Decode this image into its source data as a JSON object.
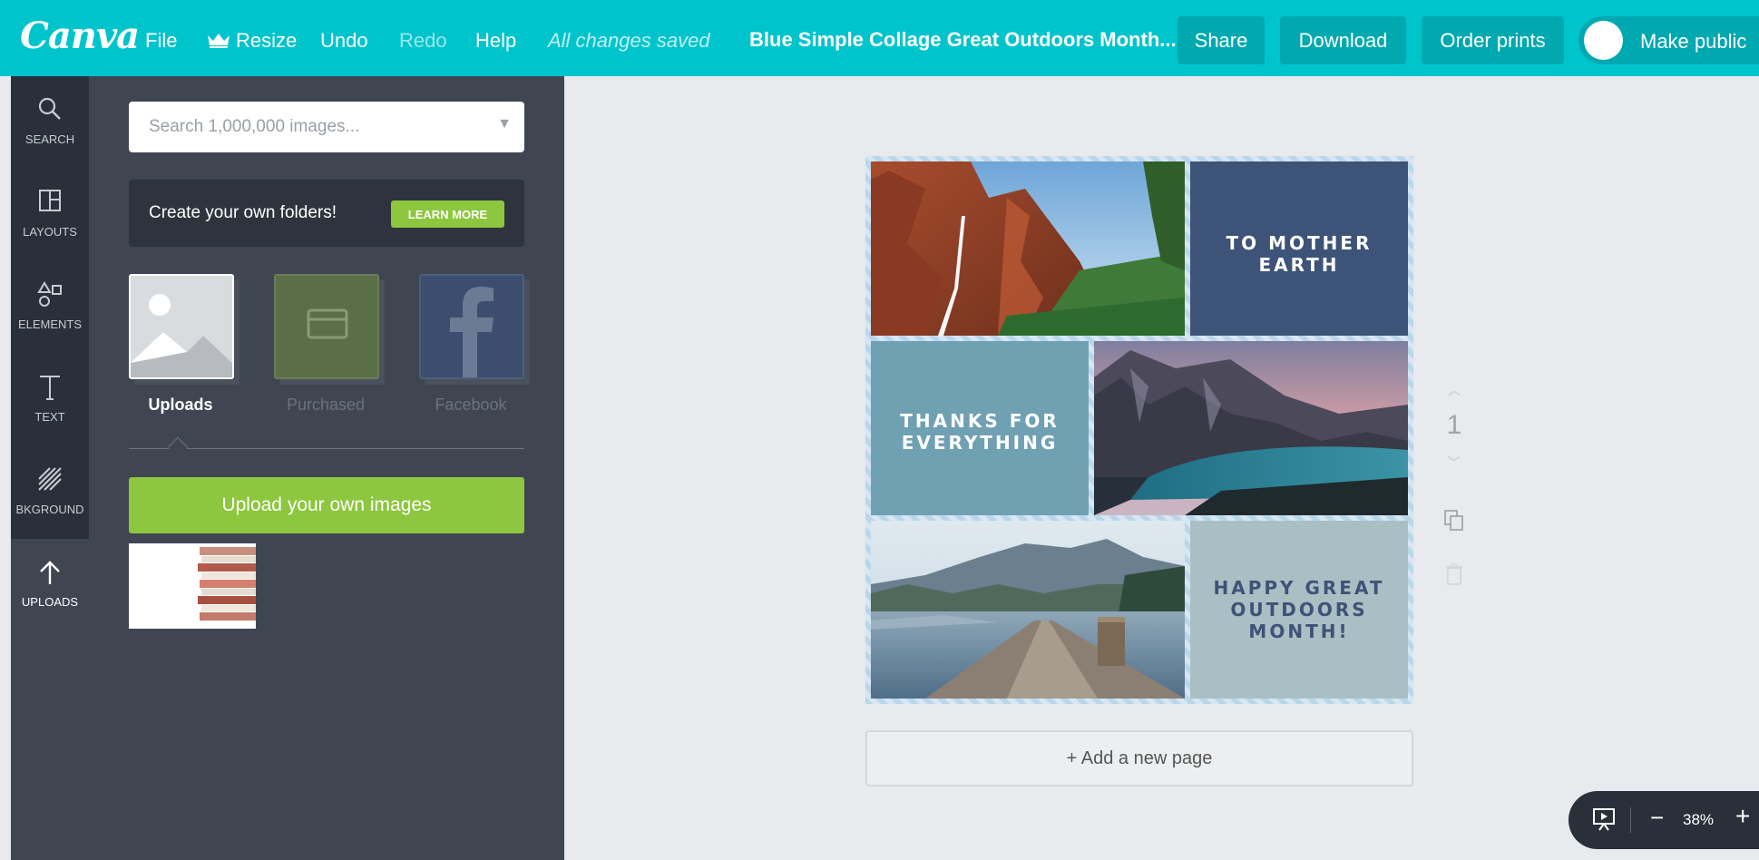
{
  "app": {
    "logo": "Canva"
  },
  "menu": {
    "file": "File",
    "resize": "Resize",
    "undo": "Undo",
    "redo": "Redo",
    "help": "Help",
    "status": "All changes saved"
  },
  "document": {
    "title": "Blue Simple Collage Great Outdoors Month..."
  },
  "actions": {
    "share": "Share",
    "download": "Download",
    "order_prints": "Order prints",
    "make_public": "Make public"
  },
  "rail": [
    {
      "label": "SEARCH",
      "icon": "search-icon"
    },
    {
      "label": "LAYOUTS",
      "icon": "layouts-icon"
    },
    {
      "label": "ELEMENTS",
      "icon": "elements-icon"
    },
    {
      "label": "TEXT",
      "icon": "text-icon"
    },
    {
      "label": "BKGROUND",
      "icon": "background-icon"
    },
    {
      "label": "UPLOADS",
      "icon": "upload-arrow-icon"
    }
  ],
  "panel": {
    "search_placeholder": "Search 1,000,000 images...",
    "folders_text": "Create your own folders!",
    "learn_more": "LEARN MORE",
    "sources": [
      {
        "label": "Uploads"
      },
      {
        "label": "Purchased"
      },
      {
        "label": "Facebook"
      }
    ],
    "upload_button": "Upload your own images"
  },
  "design": {
    "texts": {
      "mother_earth": "TO MOTHER\nEARTH",
      "thanks": "THANKS FOR\nEVERYTHING",
      "happy": "HAPPY GREAT\nOUTDOORS\nMONTH!"
    },
    "colors": {
      "navy": "#3e5378",
      "teal": "#6fa1b3",
      "sage": "#a9bfc4"
    }
  },
  "page_number": "1",
  "add_page": "+ Add a new page",
  "zoom": {
    "minus": "−",
    "level": "38%",
    "plus": "+"
  },
  "colors": {
    "brand": "#00c4cc",
    "brand_dark": "#00a9b0",
    "green": "#8dc63f",
    "rail": "#293039",
    "panel": "#3f4652"
  }
}
